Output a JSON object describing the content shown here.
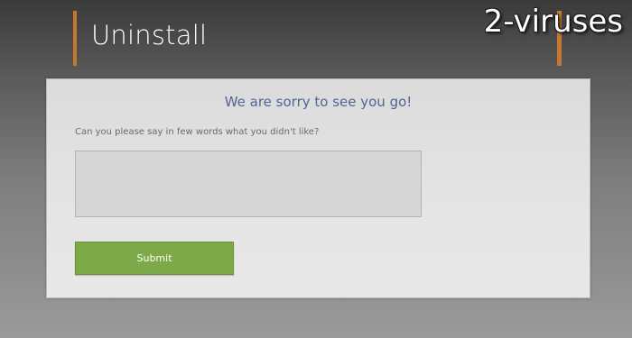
{
  "header": {
    "title": "Uninstall",
    "watermark": "2-viruses"
  },
  "form": {
    "heading": "We are sorry to see you go!",
    "question": "Can you please say in few words what you didn't like?",
    "feedback_value": "",
    "feedback_placeholder": "",
    "submit_label": "Submit"
  },
  "colors": {
    "accent": "#c8772e",
    "heading": "#4f6596",
    "submit": "#7ea948"
  }
}
